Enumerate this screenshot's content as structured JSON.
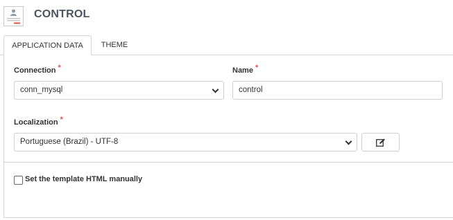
{
  "header": {
    "title": "CONTROL",
    "icon": "app-form-icon"
  },
  "tabs": [
    {
      "label": "APPLICATION DATA",
      "active": true
    },
    {
      "label": "THEME",
      "active": false
    }
  ],
  "form": {
    "connection": {
      "label": "Connection",
      "required_mark": "*",
      "value": "conn_mysql"
    },
    "name": {
      "label": "Name",
      "required_mark": "*",
      "value": "control"
    },
    "localization": {
      "label": "Localization",
      "required_mark": "*",
      "value": "Portuguese (Brazil) - UTF-8"
    },
    "edit_button_icon": "edit-icon",
    "template_checkbox": {
      "label": "Set the template HTML manually",
      "checked": false
    }
  },
  "colors": {
    "title": "#4a5460",
    "required": "#d9534f",
    "border": "#d6d6d6"
  }
}
